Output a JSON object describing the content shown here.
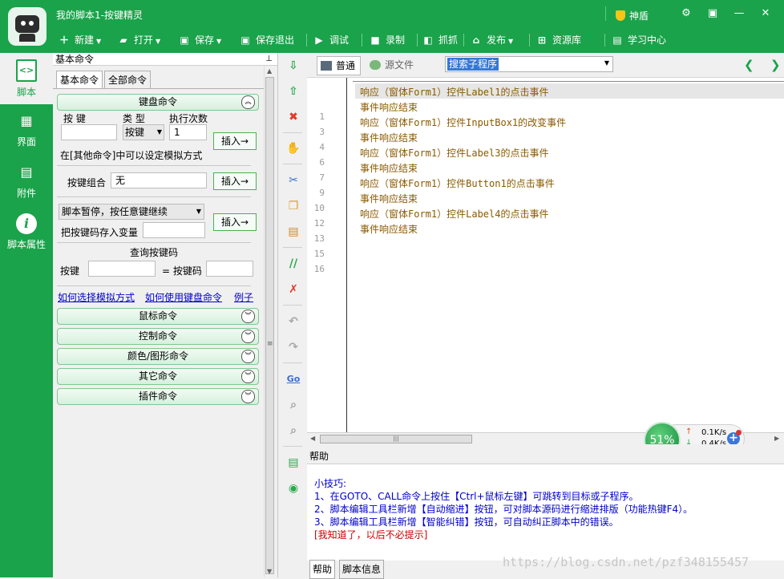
{
  "window": {
    "title": "我的脚本1-按键精灵",
    "shield_label": "神盾"
  },
  "toolbar": [
    {
      "label": "新建",
      "icon": "plus-icon",
      "dropdown": true
    },
    {
      "label": "打开",
      "icon": "folder-icon",
      "dropdown": true
    },
    {
      "label": "保存",
      "icon": "save-icon",
      "dropdown": true
    },
    {
      "label": "保存退出",
      "icon": "save-exit-icon",
      "dropdown": false
    },
    {
      "label": "调试",
      "icon": "play-icon",
      "dropdown": false
    },
    {
      "label": "录制",
      "icon": "record-icon",
      "dropdown": false
    },
    {
      "label": "抓抓",
      "icon": "grab-icon",
      "dropdown": false
    },
    {
      "label": "发布",
      "icon": "publish-icon",
      "dropdown": true
    },
    {
      "label": "资源库",
      "icon": "resource-icon",
      "dropdown": false
    },
    {
      "label": "学习中心",
      "icon": "learn-icon",
      "dropdown": false
    }
  ],
  "nav": [
    {
      "label": "脚本",
      "icon": "script-icon",
      "active": true
    },
    {
      "label": "界面",
      "icon": "ui-icon",
      "active": false
    },
    {
      "label": "附件",
      "icon": "attachment-icon",
      "active": false
    },
    {
      "label": "脚本属性",
      "icon": "info-icon",
      "active": false
    }
  ],
  "commands": {
    "header": "基本命令",
    "tabs": [
      "基本命令",
      "全部命令"
    ],
    "keyboard": {
      "title": "键盘命令",
      "col_key": "按 键",
      "col_type": "类 型",
      "col_count": "执行次数",
      "type_value": "按键",
      "count_value": "1",
      "insert": "插入→",
      "hint": "在[其他命令]中可以设定模拟方式",
      "combo_label": "按键组合",
      "combo_value": "无",
      "pause_option": "脚本暂停，按任意键继续",
      "store_label": "把按键码存入变量",
      "query_title": "查询按键码",
      "query_key": "按键",
      "query_eq": "= 按键码"
    },
    "links": [
      "如何选择模拟方式",
      "如何使用键盘命令",
      "例子"
    ],
    "sections": [
      "鼠标命令",
      "控制命令",
      "颜色/图形命令",
      "其它命令",
      "插件命令"
    ]
  },
  "editor": {
    "tabs": [
      "普通",
      "源文件"
    ],
    "sub_select": "搜索子程序",
    "lines": [
      {
        "n": "1",
        "text": "响应（窗体Form1）控件Label1的点击事件"
      },
      {
        "n": "3",
        "text": "事件响应结束"
      },
      {
        "n": "4",
        "text": "响应（窗体Form1）控件InputBox1的改变事件"
      },
      {
        "n": "6",
        "text": "事件响应结束"
      },
      {
        "n": "7",
        "text": "响应（窗体Form1）控件Label3的点击事件"
      },
      {
        "n": "9",
        "text": "事件响应结束"
      },
      {
        "n": "10",
        "text": "响应（窗体Form1）控件Button1的点击事件"
      },
      {
        "n": "12",
        "text": "事件响应结束"
      },
      {
        "n": "13",
        "text": "响应（窗体Form1）控件Label4的点击事件"
      },
      {
        "n": "15",
        "text": "事件响应结束"
      },
      {
        "n": "16",
        "text": ""
      }
    ]
  },
  "perf": {
    "usage": "51%",
    "up": "0.1K/s",
    "down": "0.4K/s"
  },
  "help": {
    "title": "帮助",
    "tip_title": "小技巧:",
    "tips": [
      "1、在GOTO、CALL命令上按住【Ctrl+鼠标左键】可跳转到目标或子程序。",
      "2、脚本编辑工具栏新增【自动缩进】按钮，可对脚本源码进行缩进排版（功能热键F4）。",
      "3、脚本编辑工具栏新增【智能纠错】按钮，可自动纠正脚本中的错误。"
    ],
    "dismiss": "[我知道了，以后不必提示]",
    "tabs": [
      "帮助",
      "脚本信息"
    ],
    "watermark": "https://blog.csdn.net/pzf348155457"
  },
  "colors": {
    "brand_green": "#1aa34a",
    "code_text": "#8a5a00",
    "tip_blue": "#0000cc",
    "dismiss_red": "#cc0000"
  }
}
